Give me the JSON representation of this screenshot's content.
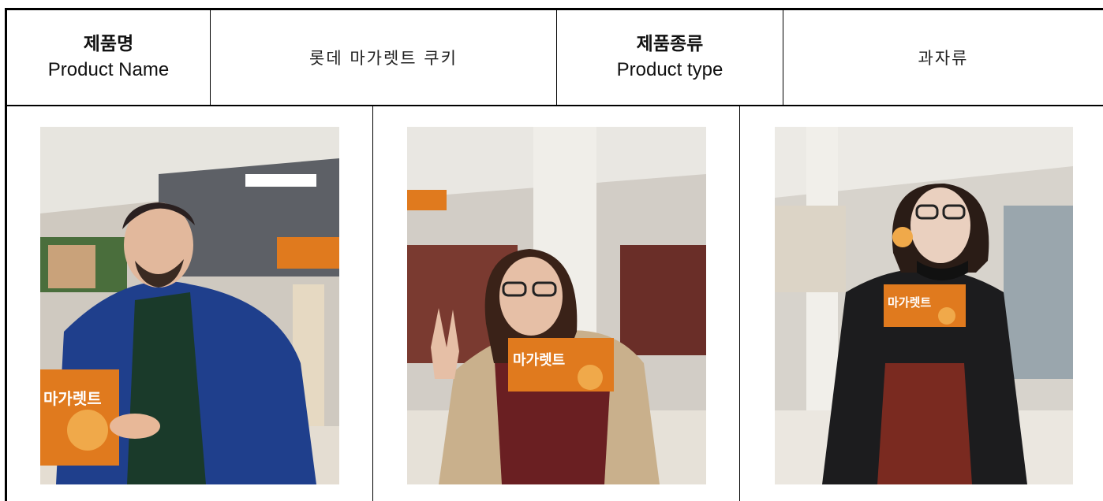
{
  "header": {
    "product_name_label_ko": "제품명",
    "product_name_label_en": "Product Name",
    "product_name_value": "롯데 마가렛트 쿠키",
    "product_type_label_ko": "제품종류",
    "product_type_label_en": "Product type",
    "product_type_value": "과자류"
  },
  "photos": [
    {
      "box_text": "마가렛트",
      "person": "man-blue-jacket"
    },
    {
      "box_text": "마가렛트",
      "person": "woman-peace-sign"
    },
    {
      "box_text": "마가렛트",
      "person": "woman-leather-jacket"
    }
  ],
  "colors": {
    "border": "#000000",
    "box_orange": "#e07a1e",
    "box_red": "#c0251a"
  }
}
